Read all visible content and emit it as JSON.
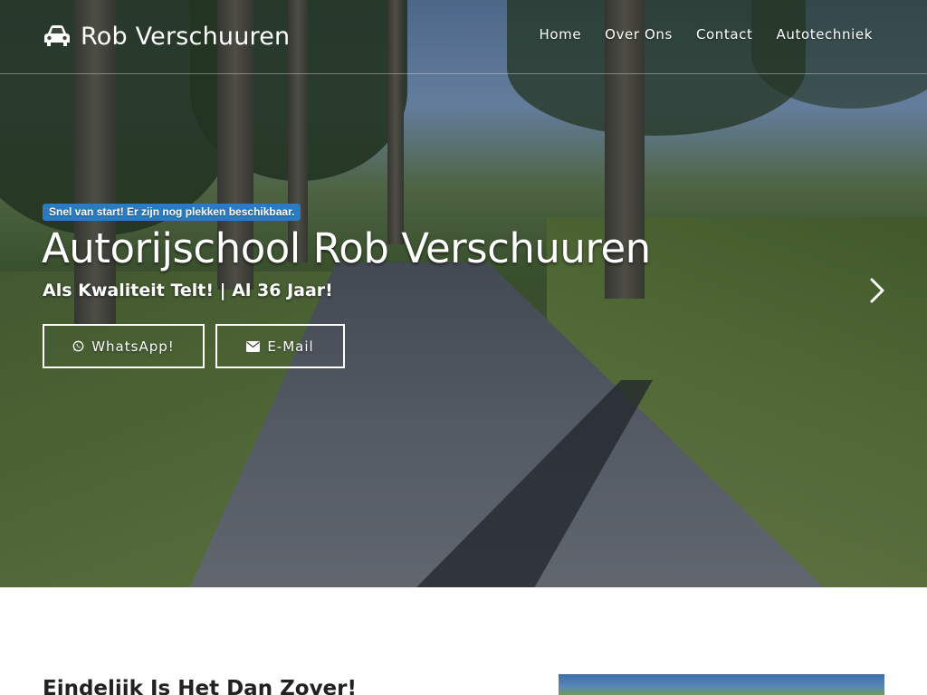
{
  "navbar": {
    "brand": {
      "icon": "car-icon",
      "text": "Rob Verschuuren"
    },
    "links": [
      "Home",
      "Over Ons",
      "Contact",
      "Autotechniek"
    ]
  },
  "hero": {
    "badge": "Snel van start! Er zijn nog plekken beschikbaar.",
    "title": "Autorijschool Rob Verschuuren",
    "subtitle": "Als Kwaliteit Telt! | Al 36 Jaar!",
    "buttons": {
      "whatsapp": {
        "icon": "whatsapp-icon",
        "label": "WhatsApp!"
      },
      "email": {
        "icon": "envelope-icon",
        "label": "E-Mail"
      }
    },
    "carousel_next_icon": "chevron-right-icon"
  },
  "section": {
    "title": "Eindelijk Is Het Dan Zover!"
  },
  "colors": {
    "badge": "#2b7bc0",
    "text": "#ffffff",
    "section_title": "#222222"
  }
}
